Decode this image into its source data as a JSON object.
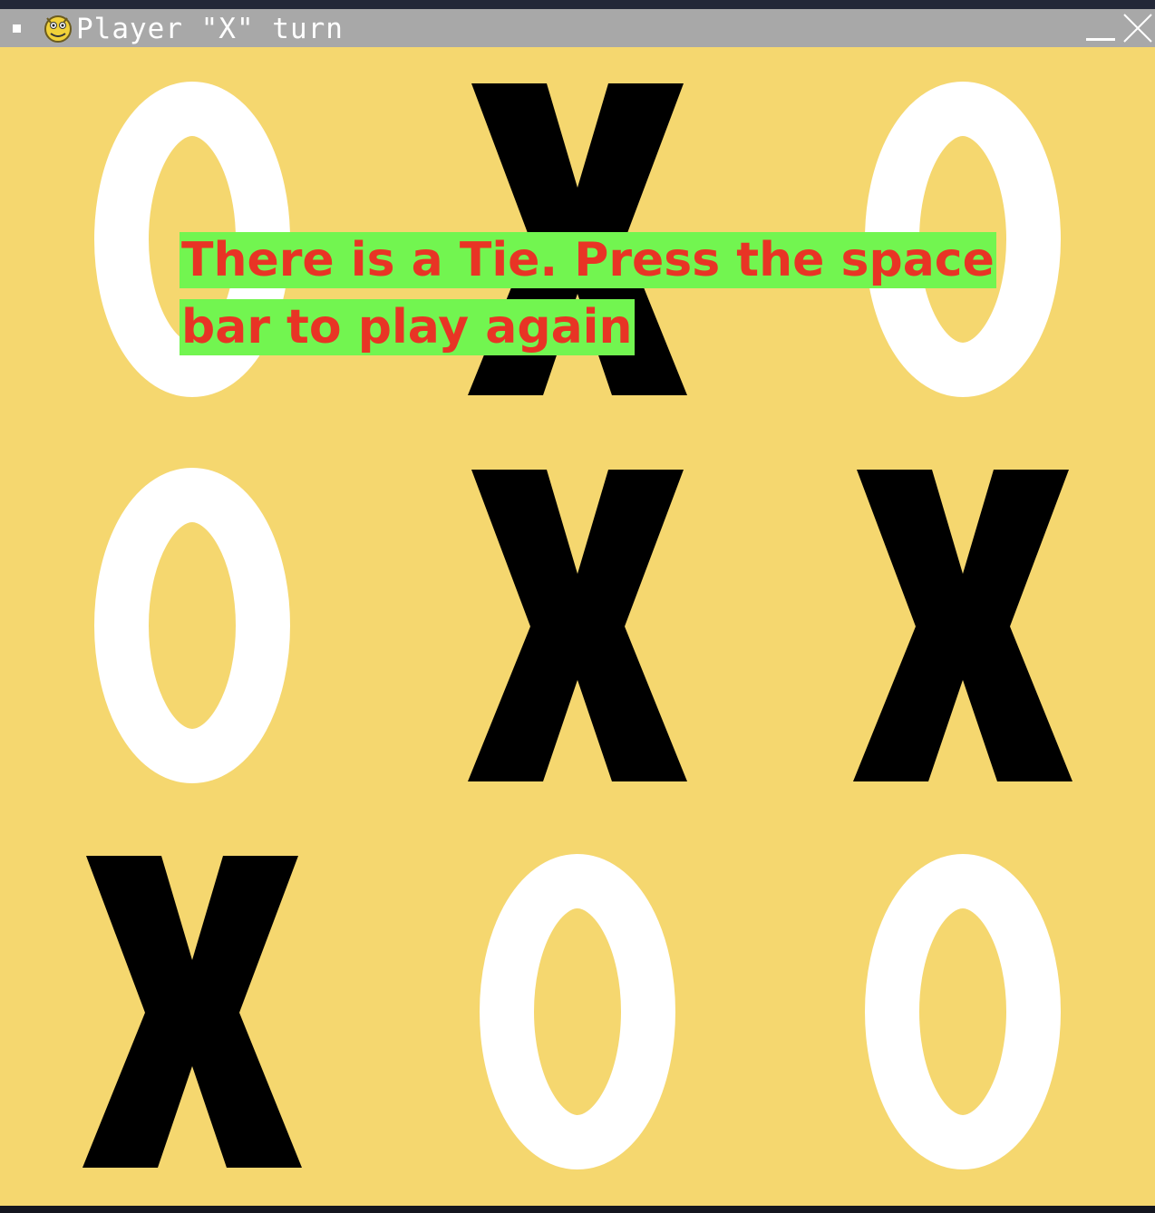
{
  "window": {
    "title": "Player \"X\" turn",
    "icon": "pygame-snake-icon"
  },
  "controls": {
    "minimize_icon": "minimize-icon",
    "close_icon": "close-icon"
  },
  "board": {
    "rows": 3,
    "cols": 3,
    "cells": [
      [
        "O",
        "X",
        "O"
      ],
      [
        "O",
        "X",
        "X"
      ],
      [
        "X",
        "O",
        "O"
      ]
    ],
    "colors": {
      "background": "#f5d76f",
      "x_mark": "#000000",
      "o_mark": "#ffffff"
    }
  },
  "message": {
    "line1": "There is a Tie. Press the space",
    "line2": "bar to play again",
    "text_color": "#e83425",
    "highlight_color": "#72f550"
  }
}
